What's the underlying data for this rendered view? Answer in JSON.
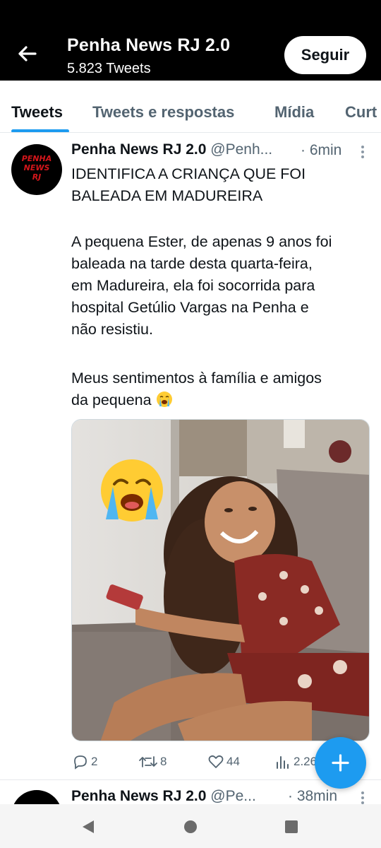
{
  "header": {
    "title": "Penha News RJ 2.0",
    "tweet_count": "5.823 Tweets",
    "follow_label": "Seguir"
  },
  "tabs": [
    {
      "label": "Tweets",
      "active": true
    },
    {
      "label": "Tweets e respostas",
      "active": false
    },
    {
      "label": "Mídia",
      "active": false
    },
    {
      "label": "Curt",
      "active": false
    }
  ],
  "tweet": {
    "avatar_text": [
      "PENHA",
      "NEWS",
      "RJ"
    ],
    "name": "Penha News RJ 2.0",
    "handle": "@Penh...",
    "time": "· 6min",
    "lines": {
      "p1l1": "IDENTIFICA A CRIANÇA QUE FOI",
      "p1l2": "BALEADA EM MADUREIRA",
      "p2l1": "A pequena Ester, de apenas 9 anos foi",
      "p2l2": "baleada na tarde desta quarta-feira,",
      "p2l3": "em Madureira, ela foi socorrida para",
      "p2l4": "hospital Getúlio Vargas na Penha e",
      "p2l5": "não resistiu.",
      "p3l1": "Meus sentimentos à família e amigos",
      "p3l2": "da pequena"
    },
    "replies": "2",
    "retweets": "8",
    "likes": "44",
    "views": "2.26"
  },
  "tweet2": {
    "name": "Penha News RJ 2.0",
    "handle": "@Pe...",
    "time": "· 38min"
  },
  "colors": {
    "accent": "#1d9bf0",
    "header_bg": "#000000",
    "secondary_text": "#536471"
  },
  "icons": [
    "back-arrow-icon",
    "more-icon",
    "reply-icon",
    "retweet-icon",
    "like-icon",
    "views-icon",
    "compose-plus-icon",
    "crying-emoji-icon",
    "nav-back-icon",
    "nav-home-icon",
    "nav-recents-icon"
  ]
}
